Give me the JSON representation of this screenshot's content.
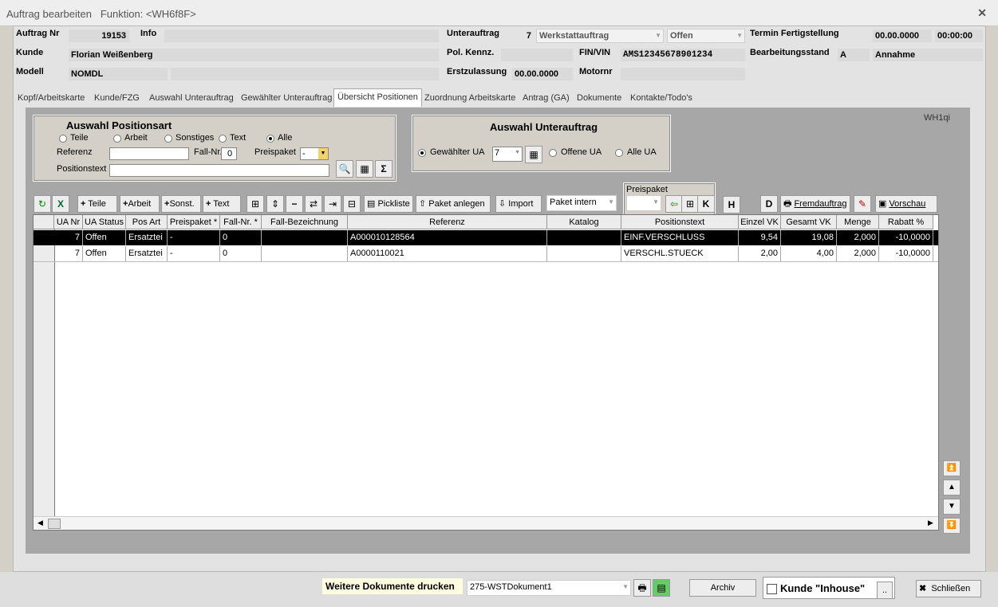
{
  "window": {
    "title": "Auftrag bearbeiten",
    "funktion": "Funktion: <WH6f8F>"
  },
  "header": {
    "auftrag_nr_label": "Auftrag Nr",
    "auftrag_nr": "19153",
    "info_label": "Info",
    "info": "",
    "kunde_label": "Kunde",
    "kunde": "Florian Weißenberg",
    "modell_label": "Modell",
    "modell": "NOMDL",
    "modell2": "",
    "unterauftrag_label": "Unterauftrag",
    "unterauftrag_nr": "7",
    "unterauftrag_type": "Werkstattauftrag",
    "unterauftrag_status": "Offen",
    "pol_kennz_label": "Pol. Kennz.",
    "pol_kennz": "",
    "fin_label": "FIN/VIN",
    "fin": "AMS12345678901234",
    "erstzulassung_label": "Erstzulassung",
    "erstzulassung": "00.00.0000",
    "motornr_label": "Motornr",
    "motornr": "",
    "termin_label": "Termin Fertigstellung",
    "termin_date": "00.00.0000",
    "termin_time": "00:00:00",
    "bearbeitungsstand_label": "Bearbeitungsstand",
    "bearbeitungsstand_code": "A",
    "bearbeitungsstand": "Annahme"
  },
  "tabs": [
    "Kopf/Arbeitskarte",
    "Kunde/FZG",
    "Auswahl Unterauftrag",
    "Gewählter Unterauftrag",
    "Übersicht Positionen",
    "Zuordnung Arbeitskarte",
    "Antrag (GA)",
    "Dokumente",
    "Kontakte/Todo's"
  ],
  "filter": {
    "title": "Auswahl Positionsart",
    "radios": [
      "Teile",
      "Arbeit",
      "Sonstiges",
      "Text",
      "Alle"
    ],
    "selected": "Alle",
    "referenz_label": "Referenz",
    "referenz": "",
    "fallnr_label": "Fall-Nr.",
    "fallnr": "0",
    "preispaket_label": "Preispaket",
    "preispaket": "-",
    "positionstext_label": "Positionstext",
    "positionstext": ""
  },
  "ua_select": {
    "title": "Auswahl Unterauftrag",
    "gewaehlt_label": "Gewählter UA",
    "gewaehlt_value": "7",
    "offene_label": "Offene UA",
    "alle_label": "Alle UA"
  },
  "wh_code": "WH1qi",
  "toolbar": {
    "teile": "Teile",
    "arbeit": "Arbeit",
    "sonst": "Sonst.",
    "text": "Text",
    "pickliste": "Pickliste",
    "paket_anlegen": "Paket anlegen",
    "import": "Import",
    "paket_intern": "Paket intern",
    "preispaket_label": "Preispaket",
    "fremdauftrag": "Fremdauftrag",
    "vorschau": "Vorschau",
    "h": "H",
    "d": "D",
    "k": "K"
  },
  "table": {
    "columns": [
      "UA Nr",
      "UA Status",
      "Pos Art",
      "Preispaket *",
      "Fall-Nr. *",
      "Fall-Bezeichnung",
      "Referenz",
      "Katalog",
      "Positionstext",
      "Einzel VK",
      "Gesamt VK",
      "Menge",
      "Rabatt %"
    ],
    "rows": [
      [
        "7",
        "Offen",
        "Ersatztei",
        "-",
        "0",
        "",
        "A000010128564",
        "",
        "EINF.VERSCHLUSS",
        "9,54",
        "19,08",
        "2,000",
        "-10,0000"
      ],
      [
        "7",
        "Offen",
        "Ersatztei",
        "-",
        "0",
        "",
        "A0000110021",
        "",
        "VERSCHL.STUECK",
        "2,00",
        "4,00",
        "2,000",
        "-10,0000"
      ]
    ]
  },
  "bottom": {
    "weitere_label": "Weitere Dokumente drucken",
    "dokument": "275-WSTDokument1",
    "archiv": "Archiv",
    "inhouse_label": "Kunde \"Inhouse\"",
    "dots": "..",
    "schliessen": "Schließen"
  }
}
